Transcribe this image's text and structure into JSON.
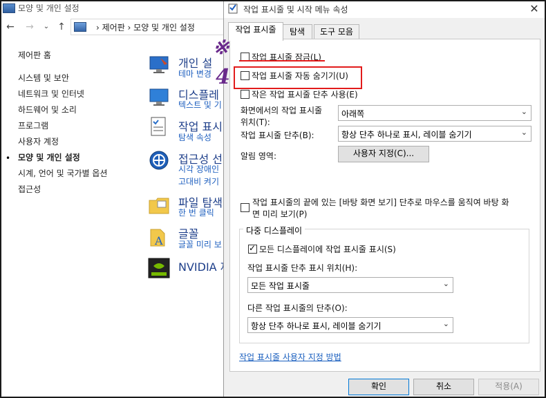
{
  "control_panel": {
    "window_title": "모양 및 개인 설정",
    "address": "› 제어판 › 모양 및 개인 설정",
    "sidebar": [
      {
        "label": "제어판 홈"
      },
      {
        "label": "시스템 및 보안"
      },
      {
        "label": "네트워크 및 인터넷"
      },
      {
        "label": "하드웨어 및 소리"
      },
      {
        "label": "프로그램"
      },
      {
        "label": "사용자 계정"
      },
      {
        "label": "모양 및 개인 설정",
        "active": true
      },
      {
        "label": "시계, 언어 및 국가별 옵션"
      },
      {
        "label": "접근성"
      }
    ],
    "categories": [
      {
        "title": "개인 설",
        "sub": [
          "테마 변경"
        ],
        "icon": "personalization-icon"
      },
      {
        "title": "디스플레",
        "sub": [
          "텍스트 및 기"
        ],
        "icon": "display-icon"
      },
      {
        "title": "작업 표시",
        "sub": [
          "탐색 속성"
        ],
        "icon": "taskbar-icon"
      },
      {
        "title": "접근성 선",
        "sub": [
          "시각 장애인",
          "고대비 켜기"
        ],
        "icon": "ease-of-access-icon"
      },
      {
        "title": "파일 탐색",
        "sub": [
          "한 번 클릭"
        ],
        "icon": "folder-options-icon"
      },
      {
        "title": "글꼴",
        "sub": [
          "글꼴 미리 보"
        ],
        "icon": "fonts-icon"
      },
      {
        "title": "NVIDIA 제",
        "sub": [],
        "icon": "nvidia-icon"
      }
    ]
  },
  "dialog": {
    "title": "작업 표시줄 및 시작 메뉴 속성",
    "tabs": [
      "작업 표시줄",
      "탐색",
      "도구 모음"
    ],
    "options": {
      "lock": "작업 표시줄 잠금(L)",
      "autohide": "작업 표시줄 자동 숨기기(U)",
      "small_buttons": "작은 작업 표시줄 단추 사용(E)"
    },
    "position_label_1": "화면에서의 작업 표시줄",
    "position_label_2": "위치(T):",
    "position_value": "아래쪽",
    "buttons_label": "작업 표시줄 단추(B):",
    "buttons_value": "항상 단추 하나로 표시, 레이블 숨기기",
    "notification_label": "알림 영역:",
    "customize_button": "사용자 지정(C)...",
    "peek_line_1": "작업 표시줄의 끝에 있는 [바탕 화면 보기] 단추로 마우스를 움직여 바탕 화",
    "peek_line_2": "면 미리 보기(P)",
    "multi_display": {
      "group_title": "다중 디스플레이",
      "show_all": "모든 디스플레이에 작업 표시줄 표시(S)",
      "show_buttons_on_label": "작업 표시줄 단추 표시 위치(H):",
      "show_buttons_on_value": "모든 작업 표시줄",
      "other_buttons_label": "다른 작업 표시줄의 단추(O):",
      "other_buttons_value": "항상 단추 하나로 표시, 레이블 숨기기"
    },
    "help_link": "작업 표시줄 사용자 지정 방법",
    "ok": "확인",
    "cancel": "취소",
    "apply": "적용(A)"
  },
  "annotations": {
    "mark": "※",
    "step": "4",
    "highlight_color": "#e21b1b"
  }
}
